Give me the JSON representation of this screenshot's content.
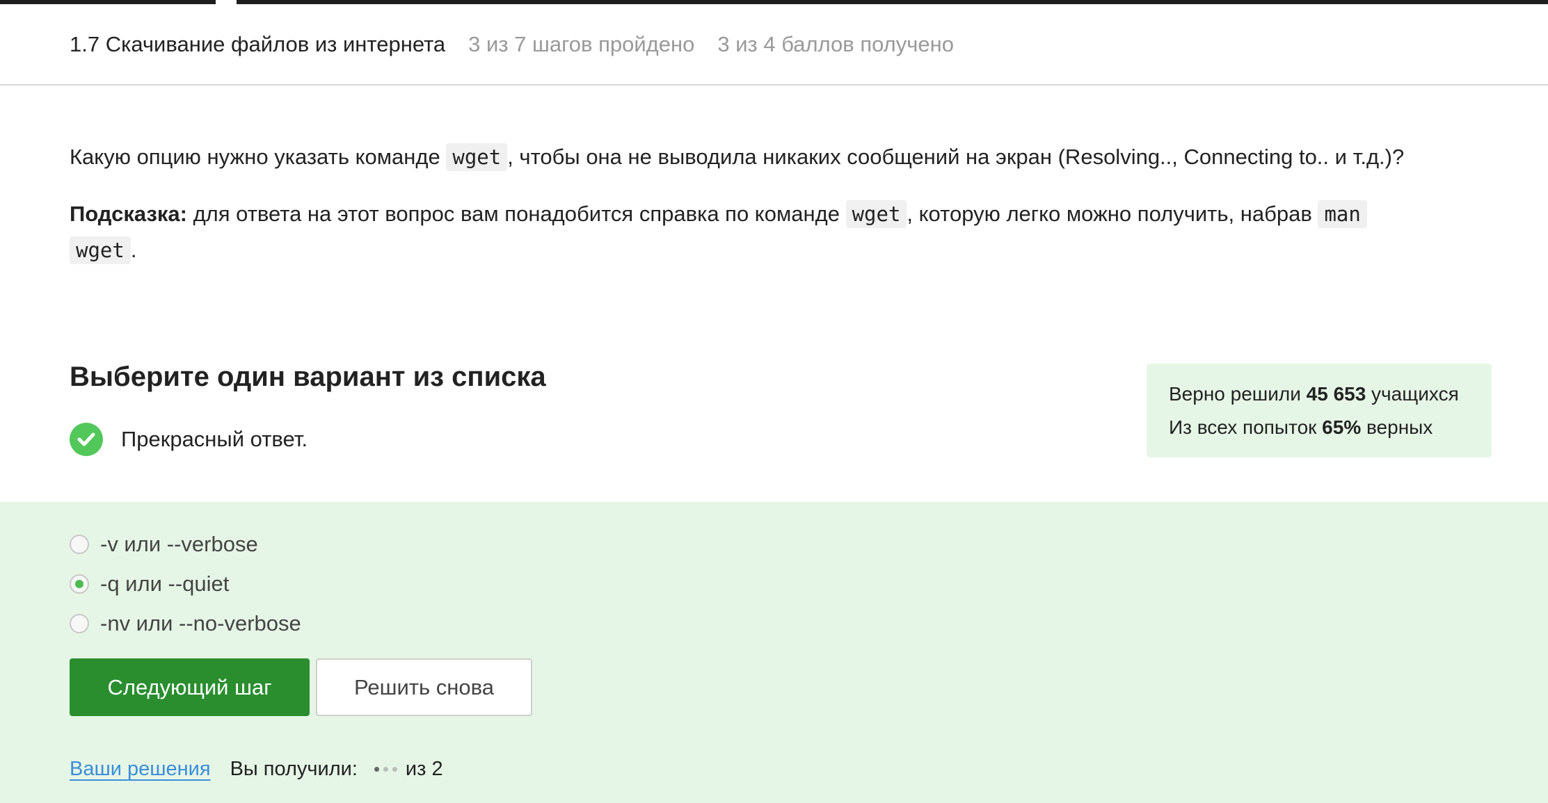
{
  "header": {
    "lesson_title": "1.7 Скачивание файлов из интернета",
    "steps_progress": "3 из 7 шагов пройдено",
    "points_progress": "3 из 4 баллов  получено"
  },
  "question": {
    "text_before_code": "Какую опцию нужно указать команде ",
    "code": "wget",
    "text_after_code": ", чтобы она не выводила никаких сообщений на экран (Resolving.., Connecting to.. и т.д.)?",
    "hint_label": "Подсказка:",
    "hint_text_1": " для ответа на этот вопрос вам понадобится справка по команде ",
    "hint_code_1": "wget",
    "hint_text_2": ", которую легко можно получить, набрав ",
    "hint_code_2a": "man",
    "hint_code_2b": "wget",
    "hint_text_end": "."
  },
  "quiz": {
    "title": "Выберите один вариант из списка",
    "feedback": "Прекрасный ответ.",
    "options": [
      {
        "label": "-v или --verbose",
        "selected": false
      },
      {
        "label": "-q или --quiet",
        "selected": true
      },
      {
        "label": "-nv или --no-verbose",
        "selected": false
      }
    ],
    "next_button": "Следующий шаг",
    "retry_button": "Решить снова"
  },
  "stats": {
    "line1_prefix": "Верно решили ",
    "solved_count": "45 653",
    "line1_suffix": " учащихся",
    "line2_prefix": "Из всех попыток ",
    "correct_percent": "65%",
    "line2_suffix": " верных"
  },
  "footer": {
    "solutions_link": "Ваши решения",
    "received_label": "Вы получили:",
    "points_dots_filled": 1,
    "points_dots_total": 3,
    "out_of": "из 2"
  },
  "colors": {
    "accent_green": "#2a8e2f",
    "success_bg": "#e6f6e6",
    "check_green": "#52c85a",
    "link_blue": "#3a8edc"
  }
}
